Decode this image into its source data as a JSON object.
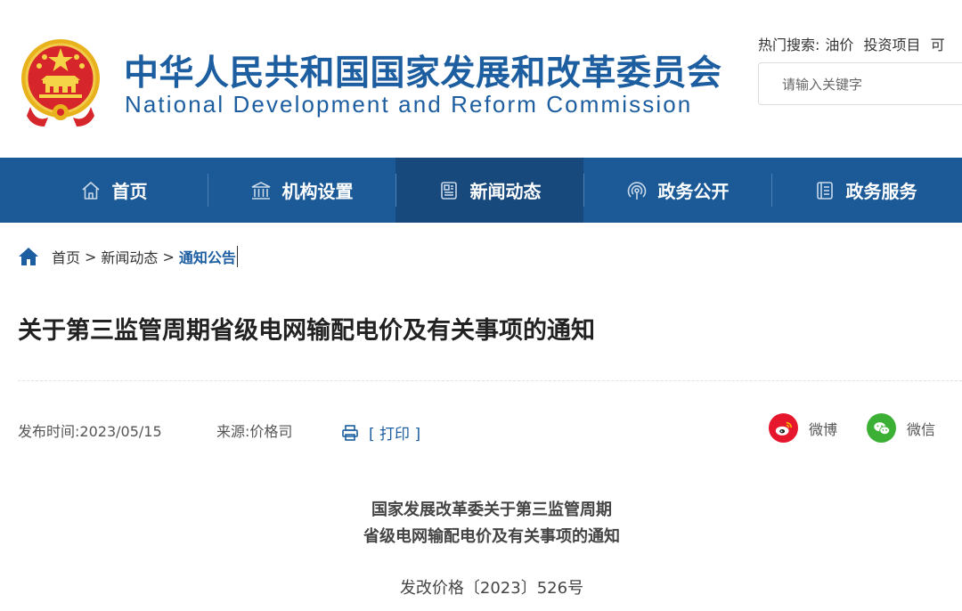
{
  "site": {
    "name_cn": "中华人民共和国国家发展和改革委员会",
    "name_en": "National Development and Reform Commission"
  },
  "search": {
    "hot_label": "热门搜索:",
    "hot_keywords": [
      "油价",
      "投资项目",
      "可"
    ],
    "placeholder": "请输入关键字"
  },
  "nav": {
    "items": [
      {
        "label": "首页",
        "icon": "home-icon"
      },
      {
        "label": "机构设置",
        "icon": "building-icon"
      },
      {
        "label": "新闻动态",
        "icon": "newspaper-icon",
        "active": true
      },
      {
        "label": "政务公开",
        "icon": "broadcast-icon"
      },
      {
        "label": "政务服务",
        "icon": "document-icon"
      }
    ]
  },
  "breadcrumb": {
    "items": [
      "首页",
      "新闻动态",
      "通知公告"
    ],
    "separator": ">"
  },
  "article": {
    "title": "关于第三监管周期省级电网输配电价及有关事项的通知",
    "date_label": "发布时间:",
    "date": "2023/05/15",
    "source_label": "来源:",
    "source": "价格司",
    "print_label": "[ 打印 ]",
    "share": {
      "weibo": "微博",
      "wechat": "微信"
    },
    "doc_heading_line1": "国家发展改革委关于第三监管周期",
    "doc_heading_line2": "省级电网输配电价及有关事项的通知",
    "doc_number": "发改价格〔2023〕526号"
  },
  "colors": {
    "brand_blue": "#1c5ea0",
    "nav_bg": "#1b5a96",
    "nav_active": "#17497c",
    "weibo_red": "#e6162d",
    "wechat_green": "#3cb034"
  }
}
